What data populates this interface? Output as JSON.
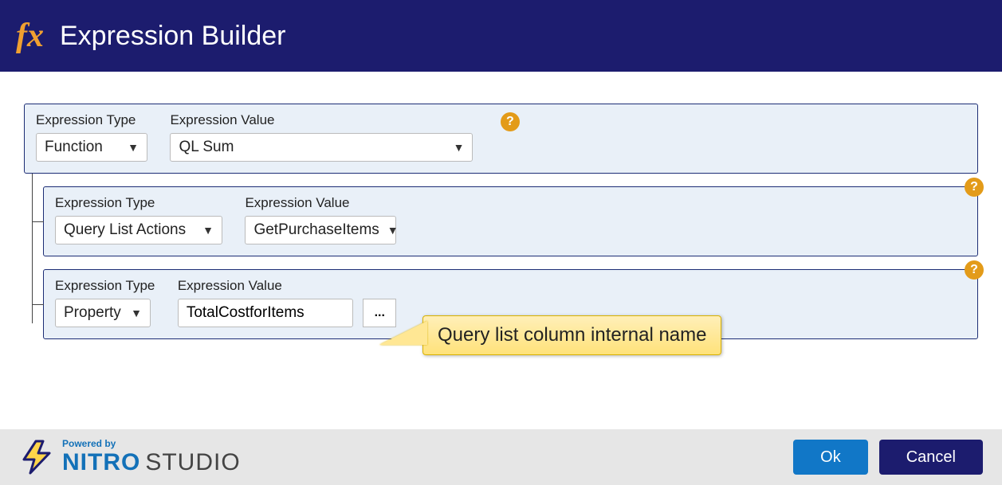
{
  "header": {
    "title": "Expression Builder",
    "icon_text": "fx"
  },
  "labels": {
    "expr_type": "Expression Type",
    "expr_value": "Expression Value"
  },
  "row1": {
    "type_value": "Function",
    "value_value": "QL Sum"
  },
  "row2": {
    "type_value": "Query List Actions",
    "value_value": "GetPurchaseItems"
  },
  "row3": {
    "type_value": "Property",
    "value_value": "TotalCostforItems",
    "dots": "..."
  },
  "help": "?",
  "callout": {
    "text": "Query list column internal name"
  },
  "footer": {
    "powered": "Powered by",
    "nitro": "NITRO",
    "studio": "STUDIO",
    "ok": "Ok",
    "cancel": "Cancel"
  }
}
